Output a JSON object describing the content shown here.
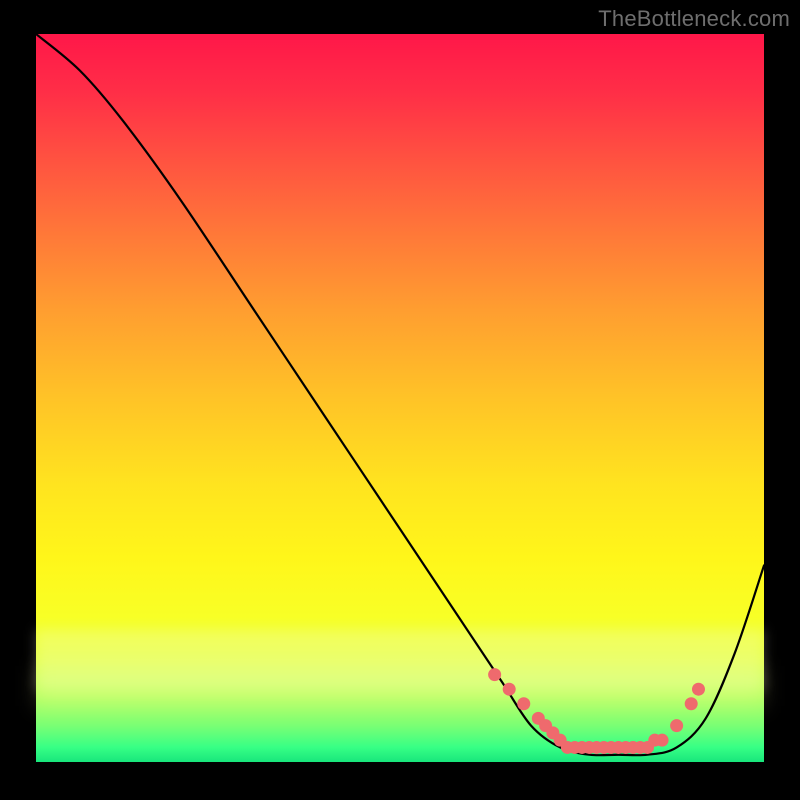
{
  "watermark": "TheBottleneck.com",
  "chart_data": {
    "type": "line",
    "title": "",
    "xlabel": "",
    "ylabel": "",
    "xlim": [
      0,
      100
    ],
    "ylim": [
      0,
      100
    ],
    "series": [
      {
        "name": "bottleneck-curve",
        "x": [
          0,
          6,
          12,
          20,
          30,
          40,
          50,
          58,
          64,
          68,
          72,
          76,
          80,
          84,
          88,
          92,
          96,
          100
        ],
        "y": [
          100,
          95,
          88,
          77,
          62,
          47,
          32,
          20,
          11,
          5,
          2,
          1,
          1,
          1,
          2,
          6,
          15,
          27
        ]
      }
    ],
    "highlight_points": {
      "name": "optimal-range",
      "x": [
        63,
        65,
        67,
        69,
        70,
        71,
        72,
        73,
        74,
        75,
        76,
        77,
        78,
        79,
        80,
        81,
        82,
        83,
        84,
        85,
        86,
        88,
        90,
        91
      ],
      "y": [
        12,
        10,
        8,
        6,
        5,
        4,
        3,
        2,
        2,
        2,
        2,
        2,
        2,
        2,
        2,
        2,
        2,
        2,
        2,
        3,
        3,
        5,
        8,
        10
      ]
    },
    "gradient_meaning": "red (top) = high bottleneck, green (bottom) = low bottleneck"
  },
  "colors": {
    "curve": "#000000",
    "dot": "#ef6a6d",
    "background": "#000000"
  }
}
